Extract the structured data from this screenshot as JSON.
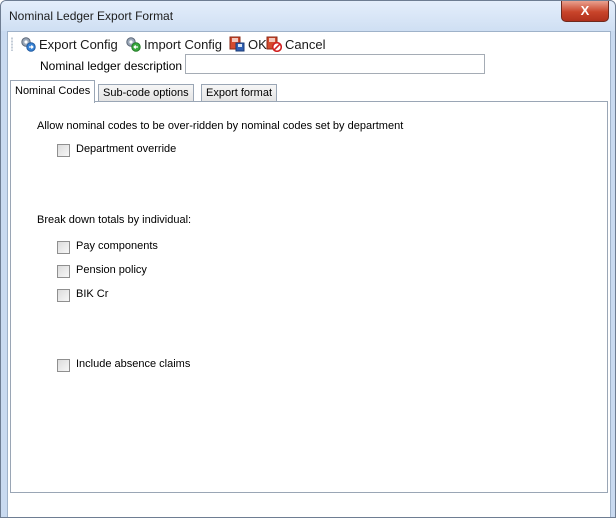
{
  "window": {
    "title": "Nominal Ledger Export Format",
    "close_glyph": "X"
  },
  "toolbar": {
    "export_label": "Export Config",
    "import_label": "Import Config",
    "ok_label": "OK",
    "cancel_label": "Cancel"
  },
  "description": {
    "label": "Nominal ledger description",
    "value": ""
  },
  "tabs": [
    {
      "label": "Nominal Codes",
      "active": true
    },
    {
      "label": "Sub-code options",
      "active": false
    },
    {
      "label": "Export format",
      "active": false
    }
  ],
  "nominal_codes": {
    "override_heading": "Allow nominal codes to be over-ridden by nominal codes set by department",
    "department_override": {
      "label": "Department override",
      "checked": false
    },
    "breakdown_heading": "Break down totals by individual:",
    "pay_components": {
      "label": "Pay components",
      "checked": false
    },
    "pension_policy": {
      "label": "Pension policy",
      "checked": false
    },
    "bik_cr": {
      "label": "BIK Cr",
      "checked": false
    },
    "include_absence": {
      "label": "Include absence claims",
      "checked": false
    }
  },
  "colors": {
    "window_frame": "#c9daf0",
    "close_button": "#c8442a"
  }
}
